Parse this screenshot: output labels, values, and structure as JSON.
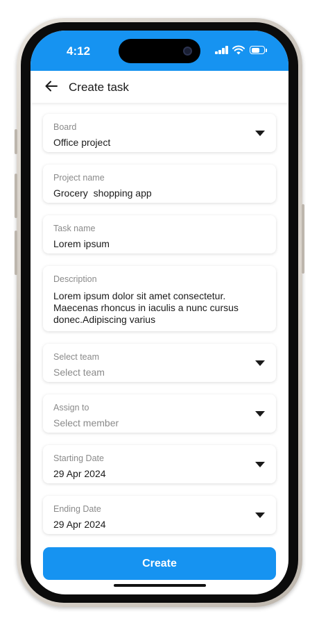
{
  "status_bar": {
    "time": "4:12",
    "icons": [
      "signal-icon",
      "wifi-icon",
      "battery-icon"
    ]
  },
  "header": {
    "back_icon": "arrow-left-icon",
    "title": "Create task"
  },
  "form": {
    "fields": [
      {
        "label": "Board",
        "value": "Office project",
        "placeholder": false,
        "dropdown": true
      },
      {
        "label": "Project name",
        "value": "Grocery  shopping app",
        "placeholder": false,
        "dropdown": false
      },
      {
        "label": "Task name",
        "value": "Lorem ipsum",
        "placeholder": false,
        "dropdown": false
      },
      {
        "label": "Description",
        "value": [
          "Lorem ipsum dolor sit amet consectetur.",
          "Maecenas rhoncus in iaculis a nunc cursus",
          "donec.Adipiscing varius"
        ],
        "placeholder": false,
        "dropdown": false
      },
      {
        "label": "Select team",
        "value": "Select team",
        "placeholder": true,
        "dropdown": true
      },
      {
        "label": "Assign to",
        "value": "Select member",
        "placeholder": true,
        "dropdown": true
      },
      {
        "label": "Starting Date",
        "value": "29 Apr 2024",
        "placeholder": false,
        "dropdown": true
      },
      {
        "label": "Ending Date",
        "value": "29 Apr 2024",
        "placeholder": false,
        "dropdown": true
      }
    ]
  },
  "actions": {
    "create_label": "Create"
  },
  "colors": {
    "accent": "#1693f1",
    "text": "#1a1a1a",
    "label": "#8a8a8a"
  }
}
